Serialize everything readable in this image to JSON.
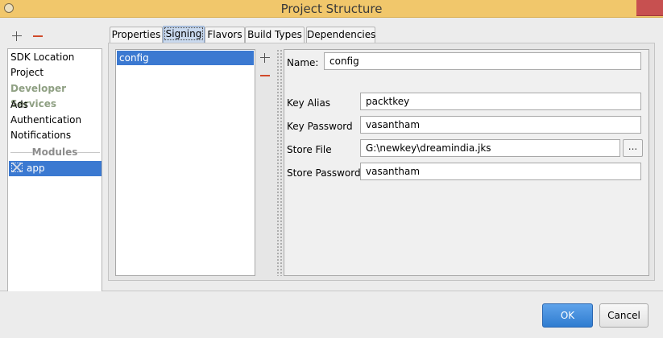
{
  "window": {
    "title": "Project Structure",
    "title_bar_color": "#f1c76b",
    "close_button_color": "#c75050"
  },
  "sidebar": {
    "items": [
      {
        "label": "SDK Location",
        "type": "item"
      },
      {
        "label": "Project",
        "type": "item"
      },
      {
        "label": "Developer Services",
        "type": "group"
      },
      {
        "label": "Ads",
        "type": "item"
      },
      {
        "label": "Authentication",
        "type": "item"
      },
      {
        "label": "Notifications",
        "type": "item"
      },
      {
        "label": "Modules",
        "type": "group"
      },
      {
        "label": "app",
        "type": "module",
        "selected": true,
        "icon": "module-icon"
      }
    ]
  },
  "tabs": [
    {
      "label": "Properties",
      "active": false
    },
    {
      "label": "Signing",
      "active": true
    },
    {
      "label": "Flavors",
      "active": false
    },
    {
      "label": "Build Types",
      "active": false
    },
    {
      "label": "Dependencies",
      "active": false
    }
  ],
  "signing_configs": {
    "items": [
      "config"
    ],
    "selected": "config"
  },
  "form": {
    "name": {
      "label": "Name:",
      "value": "config"
    },
    "key_alias": {
      "label": "Key Alias",
      "value": "packtkey"
    },
    "key_password": {
      "label": "Key Password",
      "value": "vasantham"
    },
    "store_file": {
      "label": "Store File",
      "value": "G:\\newkey\\dreamindia.jks",
      "browse_label": "..."
    },
    "store_password": {
      "label": "Store Password",
      "value": "vasantham"
    }
  },
  "footer": {
    "ok_label": "OK",
    "cancel_label": "Cancel"
  },
  "colors": {
    "selection": "#3b79d1",
    "ok_button": "#2f7cd0",
    "minus_icon": "#d04a2a"
  }
}
